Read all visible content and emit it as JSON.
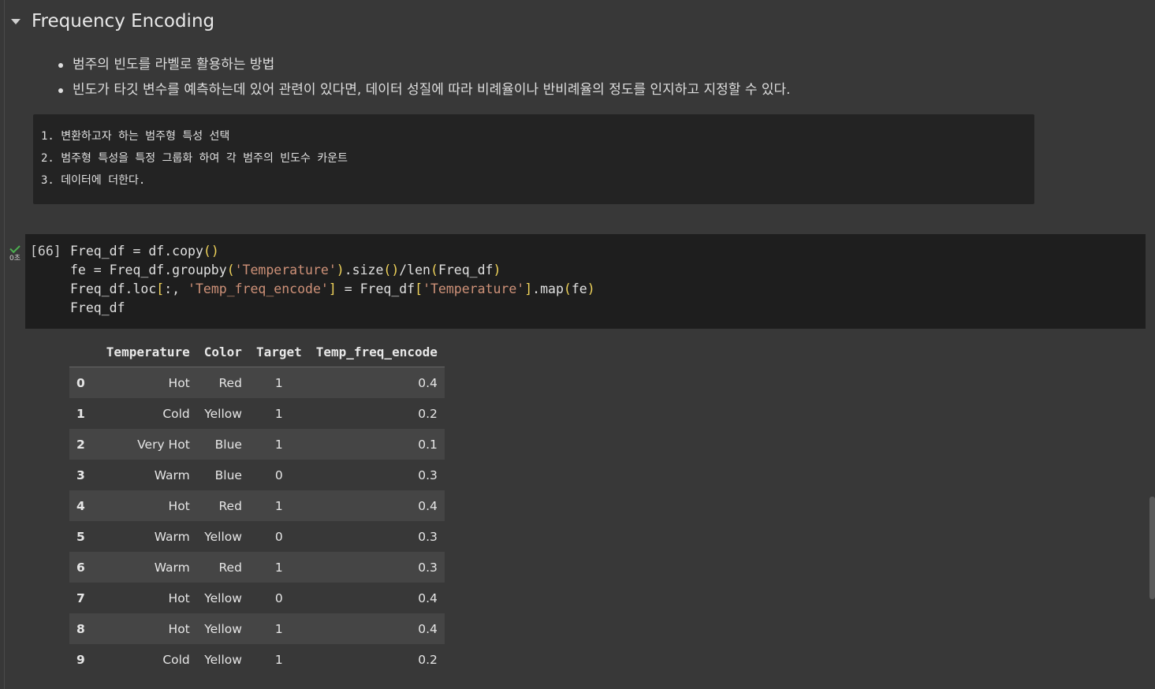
{
  "section": {
    "title": "Frequency Encoding"
  },
  "bullets": [
    "범주의 빈도를 라벨로 활용하는 방법",
    "빈도가 타깃 변수를 예측하는데 있어 관련이 있다면, 데이터 성질에 따라 비례율이나 반비례율의 정도를 인지하고 지정할 수 있다."
  ],
  "steps": [
    "1. 변환하고자 하는 범주형 특성 선택",
    "2. 범주형 특성을 특정 그룹화 하여 각 범주의 빈도수 카운트",
    "3. 데이터에 더한다."
  ],
  "code_cell": {
    "exec_count": "[66]",
    "exec_time": "0초",
    "status_icon": "check-icon",
    "code_lines": [
      "Freq_df = df.copy()",
      "fe = Freq_df.groupby('Temperature').size()/len(Freq_df)",
      "Freq_df.loc[:, 'Temp_freq_encode'] = Freq_df['Temperature'].map(fe)",
      "Freq_df"
    ]
  },
  "output_table": {
    "columns": [
      "",
      "Temperature",
      "Color",
      "Target",
      "Temp_freq_encode"
    ],
    "rows": [
      [
        "0",
        "Hot",
        "Red",
        "1",
        "0.4"
      ],
      [
        "1",
        "Cold",
        "Yellow",
        "1",
        "0.2"
      ],
      [
        "2",
        "Very Hot",
        "Blue",
        "1",
        "0.1"
      ],
      [
        "3",
        "Warm",
        "Blue",
        "0",
        "0.3"
      ],
      [
        "4",
        "Hot",
        "Red",
        "1",
        "0.4"
      ],
      [
        "5",
        "Warm",
        "Yellow",
        "0",
        "0.3"
      ],
      [
        "6",
        "Warm",
        "Red",
        "1",
        "0.3"
      ],
      [
        "7",
        "Hot",
        "Yellow",
        "0",
        "0.4"
      ],
      [
        "8",
        "Hot",
        "Yellow",
        "1",
        "0.4"
      ],
      [
        "9",
        "Cold",
        "Yellow",
        "1",
        "0.2"
      ]
    ]
  },
  "colors": {
    "background": "#383838",
    "code_background": "#1e1e1e",
    "string": "#ce9178",
    "bracket": "#f0d35a",
    "success": "#4caf50"
  }
}
